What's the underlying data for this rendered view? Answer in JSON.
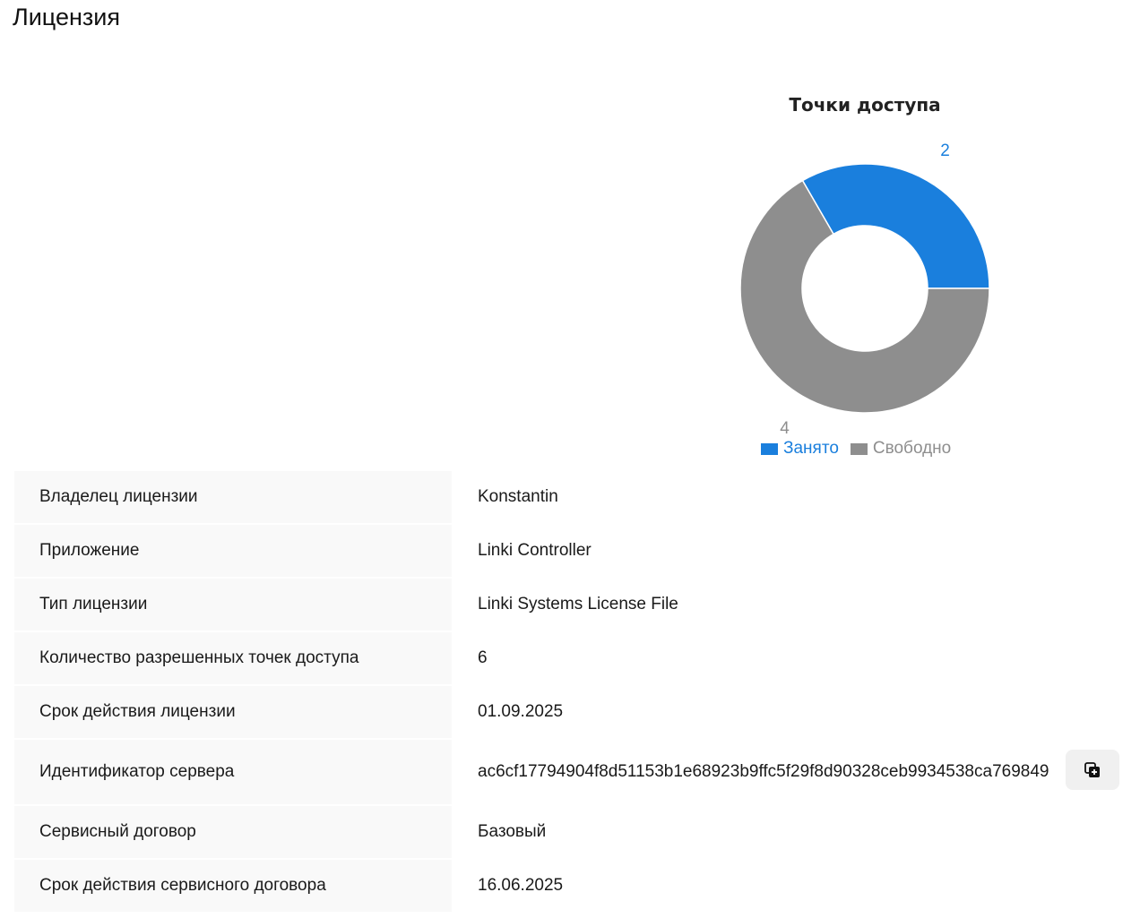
{
  "page": {
    "title": "Лицензия"
  },
  "chart_data": {
    "type": "pie",
    "title": "Точки доступа",
    "donut": true,
    "categories": [
      "Занято",
      "Свободно"
    ],
    "values": [
      2,
      4
    ],
    "colors": [
      "#1a7fdd",
      "#8e8e8e"
    ],
    "legend_position": "bottom"
  },
  "info": {
    "rows": [
      {
        "label": "Владелец лицензии",
        "value": "Konstantin"
      },
      {
        "label": "Приложение",
        "value": "Linki Controller"
      },
      {
        "label": "Тип лицензии",
        "value": "Linki Systems License File"
      },
      {
        "label": "Количество разрешенных точек доступа",
        "value": "6"
      },
      {
        "label": "Срок действия лицензии",
        "value": "01.09.2025"
      },
      {
        "label": "Идентификатор сервера",
        "value": "ac6cf17794904f8d51153b1e68923b9ffc5f29f8d90328ceb9934538ca769849"
      },
      {
        "label": "Сервисный договор",
        "value": "Базовый"
      },
      {
        "label": "Срок действия сервисного договора",
        "value": "16.06.2025"
      }
    ],
    "copy_icon": "copy-icon"
  }
}
